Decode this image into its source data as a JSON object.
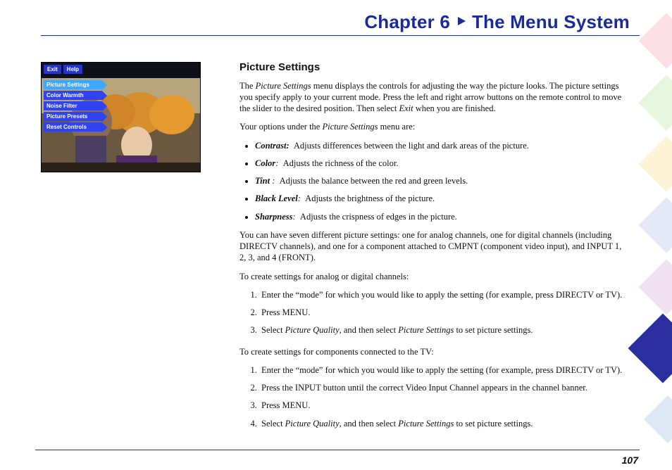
{
  "chapter": {
    "label": "Chapter 6",
    "title": "The Menu System"
  },
  "pageNumber": "107",
  "screenshot": {
    "topButtons": [
      "Exit",
      "Help"
    ],
    "menuItems": [
      "Picture Settings",
      "Color Warmth",
      "Noise Filter",
      "Picture Presets",
      "Reset Controls"
    ]
  },
  "section": {
    "heading": "Picture Settings",
    "intro": "The <em>Picture Settings</em> menu displays the controls for adjusting the way the picture looks. The picture settings you specify apply to your current mode. Press the left and right arrow buttons on the remote control to move the slider to the desired position. Then select <em>Exit</em> when you are finished.",
    "optionsLead": "Your options under the <em>Picture Settings</em> menu are:",
    "options": [
      {
        "term": "Contrast:",
        "desc": "Adjusts differences between the light and dark areas of the picture."
      },
      {
        "term": "Color",
        "sep": ":",
        "desc": "Adjusts the richness of the color."
      },
      {
        "term": "Tint",
        "sep": " :",
        "desc": "Adjusts the balance between the red and green levels."
      },
      {
        "term": "Black Level",
        "sep": ":",
        "desc": "Adjusts the brightness of the picture."
      },
      {
        "term": "Sharpness",
        "sep": ":",
        "desc": "Adjusts the crispness of edges in the picture."
      }
    ],
    "sevenPara": "You can have seven different picture settings: one for analog channels, one for digital channels (including DIRECTV channels), and one for a component attached to CMPNT (component video input), and INPUT 1, 2, 3, and 4 (FRONT).",
    "proc1Lead": "To create settings for analog or digital channels:",
    "proc1": [
      "Enter the “mode” for which you would like to apply the setting (for example, press DIRECTV or TV).",
      "Press MENU.",
      "Select <em>Picture Quality</em>, and then select <em>Picture Settings</em> to set picture settings."
    ],
    "proc2Lead": "To create settings for components connected to the TV:",
    "proc2": [
      "Enter the “mode” for which you would like to apply the setting (for example, press DIRECTV or TV).",
      "Press the INPUT button until the correct Video Input Channel appears in the channel banner.",
      "Press MENU.",
      "Select <em>Picture Quality</em>, and then select <em>Picture Settings</em> to set picture settings."
    ]
  }
}
